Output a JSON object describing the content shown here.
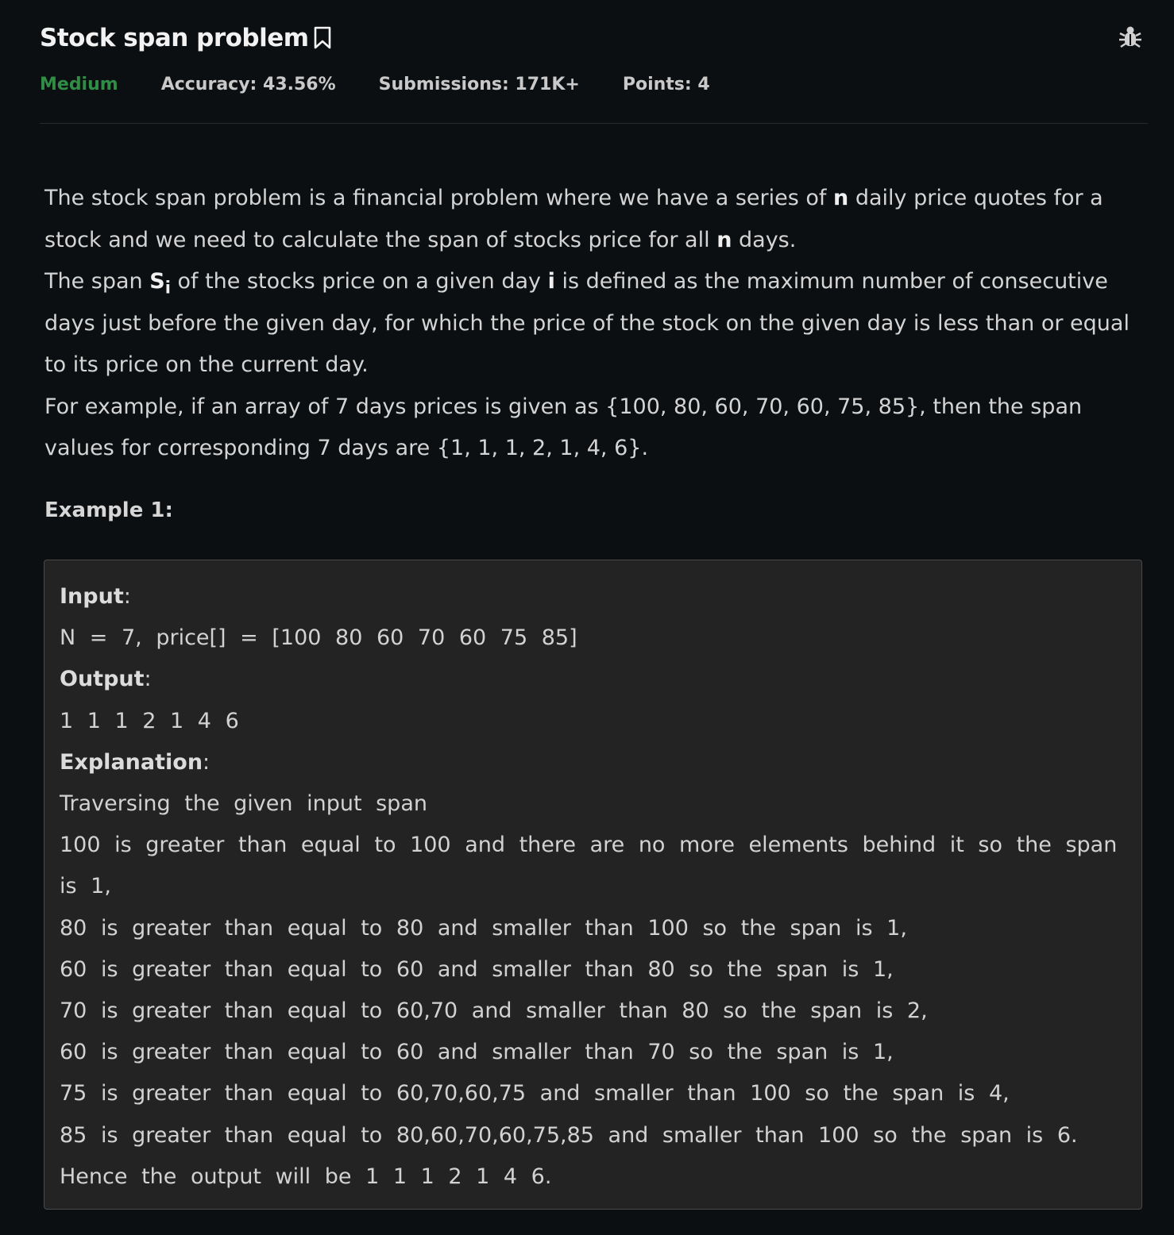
{
  "header": {
    "title": "Stock span problem",
    "difficulty": "Medium",
    "accuracy": "Accuracy: 43.56%",
    "submissions": "Submissions: 171K+",
    "points": "Points: 4",
    "icons": [
      "bookmark-icon",
      "bug-icon"
    ],
    "colors": {
      "difficulty": "#2f8d46",
      "background": "#0c0f11"
    }
  },
  "problem": {
    "p1_a": "The stock span problem is a financial problem where we have a series of ",
    "p1_n1": "n",
    "p1_b": " daily price quotes for a stock and we need to calculate the span of stocks price for all ",
    "p1_n2": "n",
    "p1_c": " days.",
    "p2_a": "The span ",
    "p2_s": "S",
    "p2_sub": "i",
    "p2_b": " of the stocks price on a given day ",
    "p2_i": "i",
    "p2_c": " is defined as the maximum number of consecutive days just before the given day, for which the price of the stock on the given day is less than or equal to its price on the current day.",
    "p3": "For example, if an array of 7 days prices is given as {100, 80, 60, 70, 60, 75, 85}, then the span values for corresponding 7 days are {1, 1, 1, 2, 1, 4, 6}."
  },
  "example": {
    "title": "Example 1:",
    "input_label": "Input",
    "input_value": "N = 7, price[] = [100 80 60 70 60 75 85]",
    "output_label": "Output",
    "output_value": "1 1 1 2 1 4 6",
    "explanation_label": "Explanation",
    "explanation_lines": [
      "Traversing the given input span",
      "100 is greater than equal to 100 and there are no more elements behind it so the span is 1,",
      "80 is greater than equal to 80 and smaller than 100 so the span is 1,",
      "60 is greater than equal to 60 and smaller than 80 so the span is 1,",
      "70 is greater than equal to 60,70 and smaller than 80 so the span is 2,",
      "60 is greater than equal to 60 and smaller than 70 so the span is 1,",
      "75 is greater than equal to 60,70,60,75 and smaller than 100 so the span is 4,",
      "85 is greater than equal to 80,60,70,60,75,85 and smaller than 100 so the span is 6.",
      "Hence the output will be 1 1 1 2 1 4 6."
    ]
  }
}
